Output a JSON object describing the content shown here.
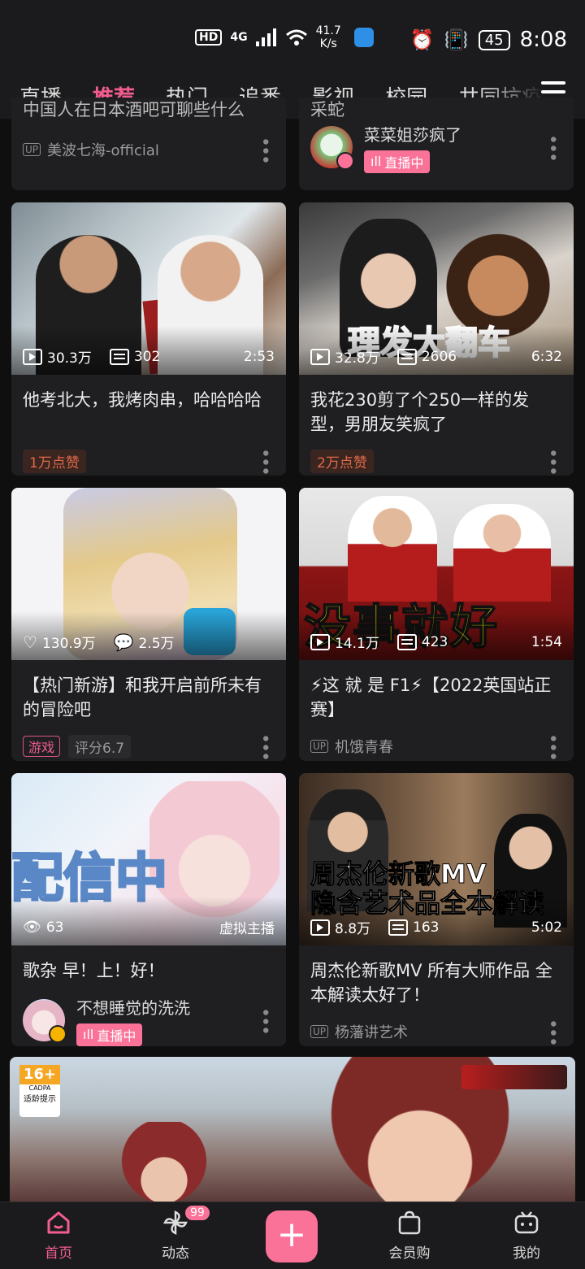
{
  "status": {
    "hd": "HD",
    "net": "4G",
    "speed_value": "41.7",
    "speed_unit": "K/s",
    "battery": "45",
    "time": "8:08"
  },
  "tabs": [
    "直播",
    "推荐",
    "热门",
    "追番",
    "影视",
    "校园",
    "共同抗疫"
  ],
  "active_tab": "推荐",
  "top_row": {
    "left": {
      "title": "中国人在日本酒吧可聊些什么",
      "up_label": "UP",
      "uploader": "美波七海-official"
    },
    "right": {
      "title": "采蛇",
      "live_user": "菜菜姐莎疯了",
      "live_label": "直播中"
    }
  },
  "cards": [
    {
      "views": "30.3万",
      "danmaku": "302",
      "duration": "2:53",
      "title": "他考北大，我烤肉串，哈哈哈哈",
      "tag": "1万点赞"
    },
    {
      "views": "32.8万",
      "danmaku": "2606",
      "duration": "6:32",
      "overlay": "理发大翻车",
      "title": "我花230剪了个250一样的发型，男朋友笑疯了",
      "tag": "2万点赞"
    },
    {
      "likes": "130.9万",
      "comments": "2.5万",
      "title": "【热门新游】和我开启前所未有的冒险吧",
      "game_tag": "游戏",
      "rating": "评分6.7"
    },
    {
      "views": "14.1万",
      "danmaku": "423",
      "duration": "1:54",
      "overlay": "没事就好",
      "title": "⚡这 就 是 F1⚡【2022英国站正赛】",
      "up_label": "UP",
      "uploader": "机饿青春"
    },
    {
      "watching": "63",
      "live_type": "虚拟主播",
      "overlay": "配信中",
      "title": "歌杂 早！上！好！",
      "live_user": "不想睡觉的洗洗",
      "live_label": "直播中"
    },
    {
      "views": "8.8万",
      "danmaku": "163",
      "duration": "5:02",
      "overlay_line1": "周杰伦新歌MV",
      "overlay_line2": "隐含艺术品全本解读",
      "title": "周杰伦新歌MV 所有大师作品 全本解读太好了！",
      "up_label": "UP",
      "uploader": "杨藩讲艺术"
    }
  ],
  "banner": {
    "age_rating": "16+",
    "cadpa": "CADPA",
    "age_hint": "适龄提示"
  },
  "nav": {
    "home": "首页",
    "dynamic": "动态",
    "dynamic_badge": "99",
    "plus": "+",
    "shop": "会员购",
    "mine": "我的"
  },
  "colors": {
    "accent": "#fb7299",
    "background": "#0f0f10",
    "card": "#1f1f22"
  }
}
